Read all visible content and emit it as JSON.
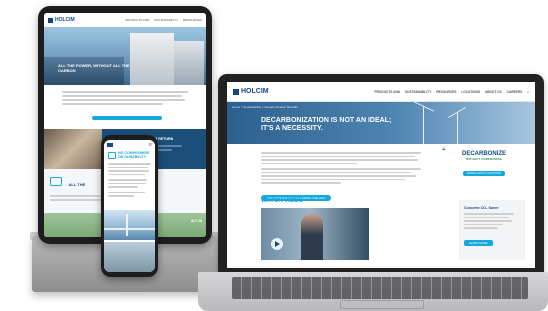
{
  "brand": {
    "name": "HOLCIM",
    "accent": "#14a8dc",
    "navy": "#13498a"
  },
  "laptop": {
    "nav": [
      "PRODUCTS AND",
      "SUSTAINABILITY",
      "RESOURCES",
      "LOCATIONS",
      "ABOUT US",
      "CAREERS"
    ],
    "breadcrumb": "Home > Sustainability > Decarbonization Benefits",
    "hero_line1": "DECARBONIZATION IS NOT AN IDEAL;",
    "hero_line2": "IT'S A NECESSITY.",
    "badge_line1": "DECARBONIZE",
    "badge_line2": "WITHOUT COMPROMISE",
    "badge_button": "DOWNLOAD TO ADOPTION",
    "cta_button": "SEE HOW HOLCIM IS LEADING THE WAY",
    "video_heading": "WATCH VIDEO",
    "side_title": "Concrete CO₂ Saver",
    "side_button": "LEARN MORE"
  },
  "tablet": {
    "hero_line1": "ALL THE POWER, WITHOUT ALL THE",
    "hero_line2": "CARBON",
    "section2_heading": "BUILD CHOICES WITH A BIG RETURN",
    "section3_heading": "ALL THE",
    "small_label": "ALT IN"
  },
  "phone": {
    "heading_line1": "NO COMPROMISE",
    "heading_line2": "ON DURABILITY"
  }
}
